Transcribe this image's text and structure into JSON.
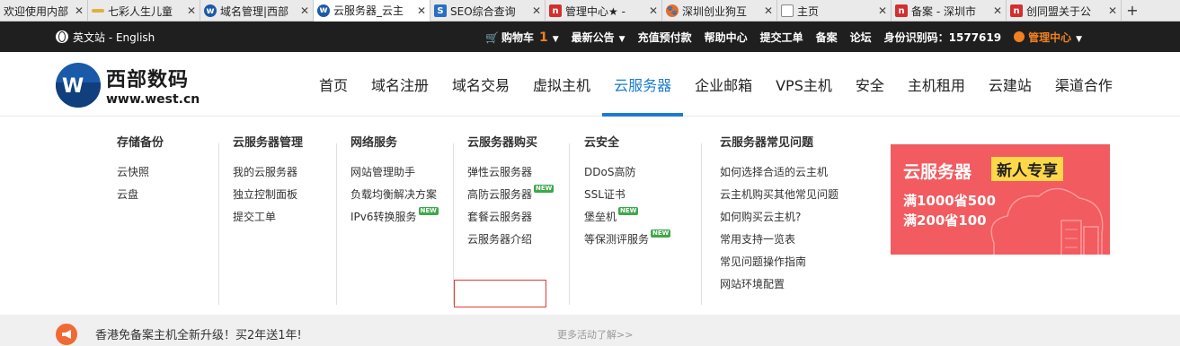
{
  "browser_tabs": [
    {
      "label": "欢迎使用内部",
      "icon": "none",
      "color": "#cfcfcf"
    },
    {
      "label": "七彩人生儿童",
      "icon": "dash-favicon",
      "color": "#e0b040"
    },
    {
      "label": "域名管理|西部",
      "icon": "west-favicon",
      "color": "#1b5aa8"
    },
    {
      "label": "云服务器_云主",
      "icon": "west-favicon",
      "color": "#1b5aa8"
    },
    {
      "label": "SEO综合查询",
      "icon": "seo-favicon",
      "color": "#2a6fc4"
    },
    {
      "label": "管理中心★ -",
      "icon": "n-favicon",
      "color": "#d32f2f"
    },
    {
      "label": "深圳创业狗互",
      "icon": "dog-favicon",
      "color": "#e07030"
    },
    {
      "label": "主页",
      "icon": "page-favicon",
      "color": "#ffffff"
    },
    {
      "label": "备案 - 深圳市",
      "icon": "n-favicon",
      "color": "#d32f2f"
    },
    {
      "label": "创同盟关于公",
      "icon": "n-favicon",
      "color": "#d32f2f"
    }
  ],
  "topbar": {
    "english": "英文站 - English",
    "cart_label": "购物车",
    "cart_count": "1",
    "news": "最新公告",
    "recharge": "充值预付款",
    "help": "帮助中心",
    "ticket": "提交工单",
    "beian": "备案",
    "forum": "论坛",
    "id_code": "身份识别码：1577619",
    "manage": "管理中心"
  },
  "logo": {
    "name": "西部数码",
    "url": "www.west.cn",
    "mark": "W"
  },
  "nav": [
    "首页",
    "域名注册",
    "域名交易",
    "虚拟主机",
    "云服务器",
    "企业邮箱",
    "VPS主机",
    "安全",
    "主机租用",
    "云建站",
    "渠道合作"
  ],
  "nav_active": "云服务器",
  "mega": {
    "storage": {
      "title": "存储备份",
      "items": [
        "云快照",
        "云盘"
      ]
    },
    "manage": {
      "title": "云服务器管理",
      "items": [
        "我的云服务器",
        "独立控制面板",
        "提交工单"
      ]
    },
    "network": {
      "title": "网络服务",
      "items": [
        "网站管理助手",
        "负载均衡解决方案",
        "IPv6转换服务"
      ]
    },
    "buy": {
      "title": "云服务器购买",
      "items": [
        "弹性云服务器",
        "高防云服务器",
        "套餐云服务器",
        "云服务器介绍"
      ]
    },
    "security": {
      "title": "云安全",
      "items": [
        "DDoS高防",
        "SSL证书",
        "堡垒机",
        "等保测评服务"
      ]
    },
    "faq": {
      "title": "云服务器常见问题",
      "items": [
        "如何选择合适的云主机",
        "云主机购买其他常见问题",
        "如何购买云主机?",
        "常用支持一览表",
        "常见问题操作指南",
        "网站环境配置"
      ]
    },
    "new_badge": "NEW"
  },
  "banner": {
    "title": "云服务器",
    "tag": "新人专享",
    "line1": "满1000省500",
    "line2": "满200省100"
  },
  "promo": {
    "text": "香港免备案主机全新升级！买2年送1年!",
    "more": "更多活动了解>>"
  },
  "colors": {
    "accent": "#1a7bd0",
    "orange": "#f08020",
    "topbar": "#1f1f1f",
    "new_badge": "#3ea84a",
    "banner": "#f25b5f"
  }
}
